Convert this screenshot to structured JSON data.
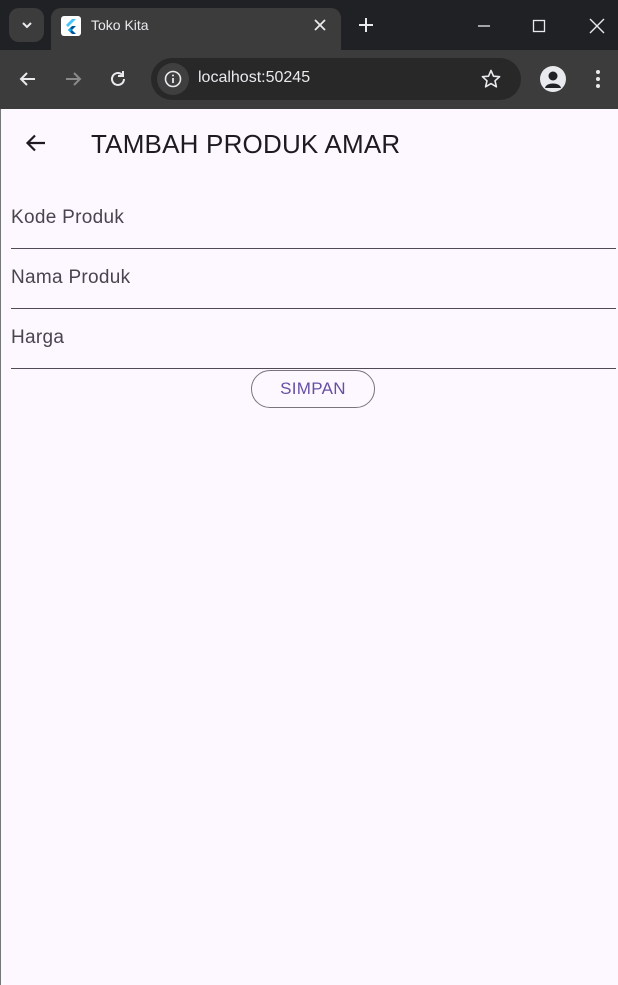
{
  "browser": {
    "tab_title": "Toko Kita",
    "url": "localhost:50245",
    "icons": {
      "tab_search": "chevron-down-icon",
      "favicon": "flutter-logo-icon",
      "tab_close": "close-icon",
      "new_tab": "plus-icon",
      "minimize": "minimize-icon",
      "maximize": "maximize-icon",
      "close_window": "close-icon",
      "back": "arrow-left-icon",
      "forward": "arrow-right-icon",
      "reload": "reload-icon",
      "site_info": "info-icon",
      "bookmark": "star-icon",
      "profile": "profile-icon",
      "menu": "more-vertical-icon"
    },
    "colors": {
      "tabstrip": "#202124",
      "toolbar": "#3c3c3c",
      "omnibox": "#282828"
    }
  },
  "app": {
    "title": "TAMBAH PRODUK AMAR",
    "back_icon": "arrow-left-icon",
    "form": {
      "fields": [
        {
          "placeholder": "Kode Produk",
          "value": ""
        },
        {
          "placeholder": "Nama Produk",
          "value": ""
        },
        {
          "placeholder": "Harga",
          "value": ""
        }
      ],
      "submit_label": "SIMPAN"
    },
    "colors": {
      "background": "#fdf7ff",
      "primary": "#6750a4",
      "outline": "#79747e"
    }
  }
}
